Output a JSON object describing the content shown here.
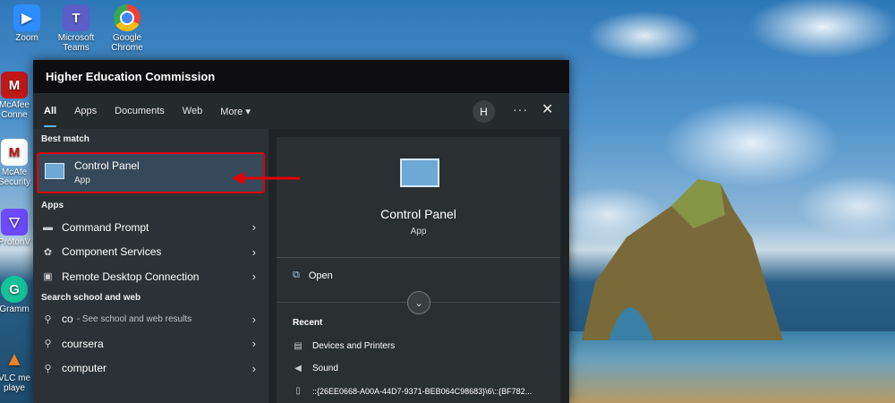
{
  "desktop": {
    "icons": [
      {
        "label": "Zoom"
      },
      {
        "label": "Microsoft Teams"
      },
      {
        "label": "Google Chrome"
      },
      {
        "label": "McAfee Conne"
      },
      {
        "label": "McAfe Security"
      },
      {
        "label": "ProtonV"
      },
      {
        "label": "Gramm"
      },
      {
        "label": "VLC me playe"
      }
    ]
  },
  "search": {
    "title": "Higher Education Commission",
    "tabs": [
      {
        "label": "All"
      },
      {
        "label": "Apps"
      },
      {
        "label": "Documents"
      },
      {
        "label": "Web"
      },
      {
        "label": "More ▾"
      }
    ],
    "avatar": "H",
    "more_dots": "···",
    "close": "✕"
  },
  "results": {
    "best_match_title": "Best match",
    "best_match": {
      "name": "Control Panel",
      "type": "App"
    },
    "apps_title": "Apps",
    "apps": [
      {
        "label": "Command Prompt"
      },
      {
        "label": "Component Services"
      },
      {
        "label": "Remote Desktop Connection"
      }
    ],
    "web_title": "Search school and web",
    "web": [
      {
        "label": "co",
        "sub": "- See school and web results"
      },
      {
        "label": "coursera",
        "sub": ""
      },
      {
        "label": "computer",
        "sub": ""
      }
    ],
    "chevron": "›"
  },
  "preview": {
    "name": "Control Panel",
    "type": "App",
    "open_label": "Open",
    "expand": "⌄",
    "recent_title": "Recent",
    "recent": [
      {
        "label": "Devices and Printers",
        "icon": "▤"
      },
      {
        "label": "Sound",
        "icon": "◀"
      },
      {
        "label": "::{26EE0668-A00A-44D7-9371-BEB064C98683}\\6\\::{BF782...",
        "icon": "▯"
      }
    ]
  },
  "colors": {
    "accent": "#60b8ff",
    "highlight_border": "#e00000"
  }
}
